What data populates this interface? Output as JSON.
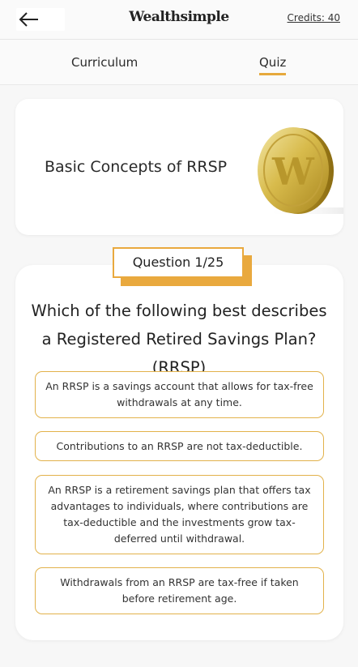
{
  "header": {
    "logo": "Wealthsimple",
    "credits": "Credits: 40",
    "back_icon": "arrow-left-icon"
  },
  "tabs": [
    {
      "label": "Curriculum",
      "active": false
    },
    {
      "label": "Quiz",
      "active": true
    }
  ],
  "lesson": {
    "title": "Basic Concepts of RRSP",
    "coin_letter": "W",
    "coin_icon": "gold-coin-icon"
  },
  "quiz": {
    "badge": "Question 1/25",
    "question": "Which of the following best describes a Registered Retired Savings Plan? (RRSP)",
    "answers": [
      "An RRSP is a savings account that allows for tax-free withdrawals at any time.",
      "Contributions to an RRSP are not tax-deductible.",
      "An RRSP is a retirement savings plan that offers tax advantages to individuals, where contributions are tax-deductible and the investments grow tax-deferred until withdrawal.",
      "Withdrawals from an RRSP are tax-free if taken before retirement age."
    ]
  },
  "colors": {
    "accent": "#e9a93e",
    "background": "#f7f7f7",
    "card": "#ffffff"
  }
}
